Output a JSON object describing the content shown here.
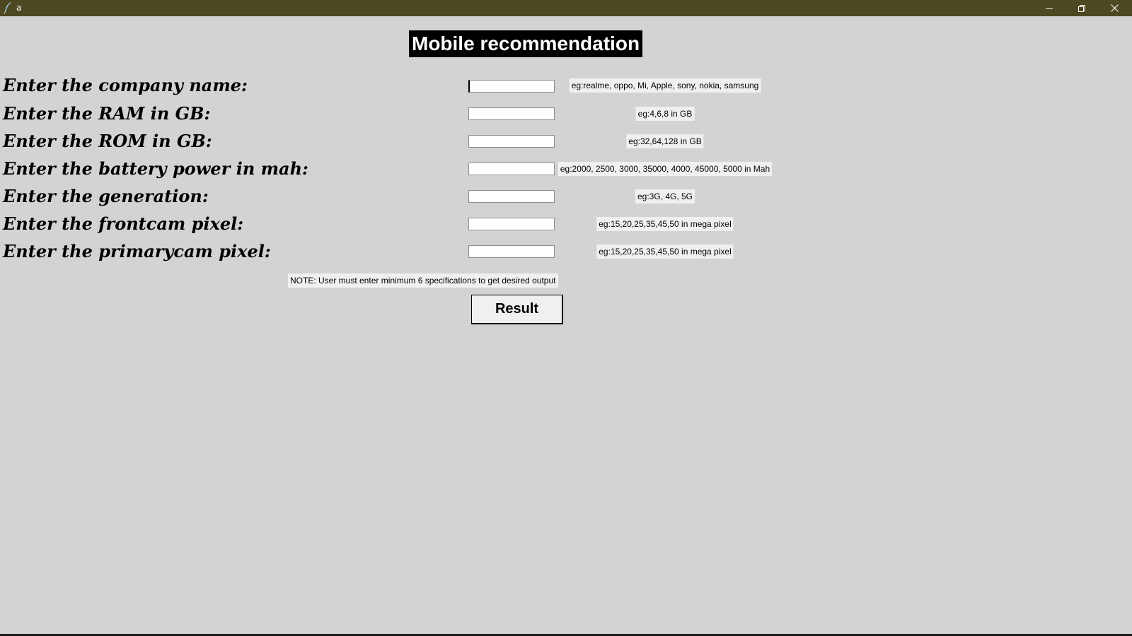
{
  "window": {
    "title": "a",
    "app_icon": "feather-icon",
    "controls": [
      "minimize-icon",
      "restore-icon",
      "close-icon"
    ],
    "titlebar_color": "#4b4822"
  },
  "heading": "Mobile recommendation",
  "fields": [
    {
      "label": "Enter the company name:",
      "value": "",
      "hint": "eg:realme, oppo, Mi, Apple, sony, nokia, samsung"
    },
    {
      "label": "Enter the RAM in GB:",
      "value": "",
      "hint": "eg:4,6,8 in GB"
    },
    {
      "label": "Enter the ROM in GB:",
      "value": "",
      "hint": "eg:32,64,128 in GB"
    },
    {
      "label": "Enter the battery power in mah:",
      "value": "",
      "hint": "eg:2000, 2500, 3000, 35000, 4000, 45000, 5000 in Mah"
    },
    {
      "label": "Enter the generation:",
      "value": "",
      "hint": "eg:3G, 4G, 5G"
    },
    {
      "label": "Enter the frontcam pixel:",
      "value": "",
      "hint": "eg:15,20,25,35,45,50 in mega pixel"
    },
    {
      "label": "Enter the primarycam pixel:",
      "value": "",
      "hint": "eg:15,20,25,35,45,50 in mega pixel"
    }
  ],
  "note": "NOTE: User must enter minimum 6 specifications to get desired output",
  "result_button": "Result",
  "colors": {
    "background": "#d3d3d3",
    "heading_bg": "#000000",
    "heading_text": "#ffffff",
    "hint_bg": "#f0f0f0"
  }
}
